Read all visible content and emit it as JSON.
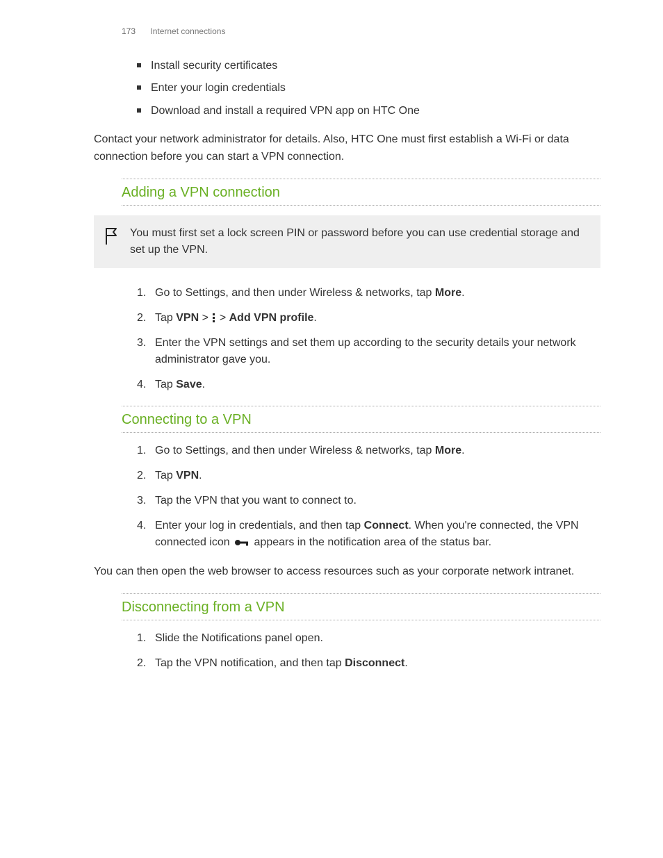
{
  "header": {
    "page_number": "173",
    "section": "Internet connections"
  },
  "intro_bullets": [
    "Install security certificates",
    "Enter your login credentials",
    "Download and install a required VPN app on HTC One"
  ],
  "intro_paragraph": "Contact your network administrator for details. Also, HTC One must first establish a Wi-Fi or data connection before you can start a VPN connection.",
  "section_adding": {
    "title": "Adding a VPN connection",
    "note": "You must first set a lock screen PIN or password before you can use credential storage and set up the VPN.",
    "steps": {
      "s1_pre": "Go to Settings, and then under Wireless & networks, tap ",
      "s1_bold": "More",
      "s1_post": ".",
      "s2_pre": "Tap ",
      "s2_vpn": "VPN",
      "s2_arrow1": " > ",
      "s2_arrow2": " > ",
      "s2_add": "Add VPN profile",
      "s2_post": ".",
      "s3": "Enter the VPN settings and set them up according to the security details your network administrator gave you.",
      "s4_pre": "Tap ",
      "s4_bold": "Save",
      "s4_post": "."
    }
  },
  "section_connecting": {
    "title": "Connecting to a VPN",
    "steps": {
      "s1_pre": "Go to Settings, and then under Wireless & networks, tap ",
      "s1_bold": "More",
      "s1_post": ".",
      "s2_pre": "Tap ",
      "s2_bold": "VPN",
      "s2_post": ".",
      "s3": "Tap the VPN that you want to connect to.",
      "s4_pre": "Enter your log in credentials, and then tap ",
      "s4_bold": "Connect",
      "s4_mid": ". When you're connected, the VPN connected icon ",
      "s4_post": " appears in the notification area of the status bar."
    },
    "after": "You can then open the web browser to access resources such as your corporate network intranet."
  },
  "section_disconnecting": {
    "title": "Disconnecting from a VPN",
    "steps": {
      "s1": "Slide the Notifications panel open.",
      "s2_pre": "Tap the VPN notification, and then tap ",
      "s2_bold": "Disconnect",
      "s2_post": "."
    }
  }
}
